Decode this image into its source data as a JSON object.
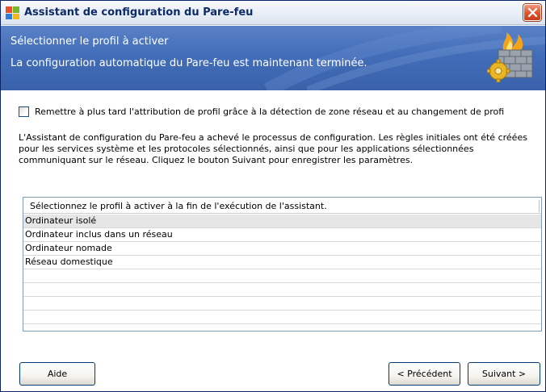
{
  "window": {
    "title": "Assistant de configuration du Pare-feu"
  },
  "banner": {
    "line1": "Sélectionner le profil à activer",
    "line2": "La configuration automatique du Pare-feu est maintenant terminée."
  },
  "options": {
    "defer_checkbox_label": "Remettre à plus tard l'attribution de profil grâce à la détection de zone réseau et au changement de profi",
    "defer_checkbox_checked": false
  },
  "description": "L'Assistant de configuration du Pare-feu a achevé le processus de configuration. Les règles initiales ont été créées pour les services système et les protocoles sélectionnés, ainsi que pour les applications sélectionnées communiquant sur le réseau. Cliquez le bouton Suivant pour enregistrer les paramètres.",
  "profile_list": {
    "header": "Sélectionnez le profil à activer à la fin de l'exécution de l'assistant.",
    "items": [
      "Ordinateur isolé",
      "Ordinateur inclus dans un réseau",
      "Ordinateur nomade",
      "Réseau domestique"
    ],
    "selected_index": 0
  },
  "buttons": {
    "help": "Aide",
    "previous": "< Précédent",
    "next": "Suivant >"
  },
  "icons": {
    "app": "firewall-app-icon",
    "close": "close-icon",
    "banner": "firewall-wall-icon"
  },
  "colors": {
    "banner_blue": "#426db8",
    "close_red": "#e1572f",
    "title_text": "#0d2b66"
  }
}
